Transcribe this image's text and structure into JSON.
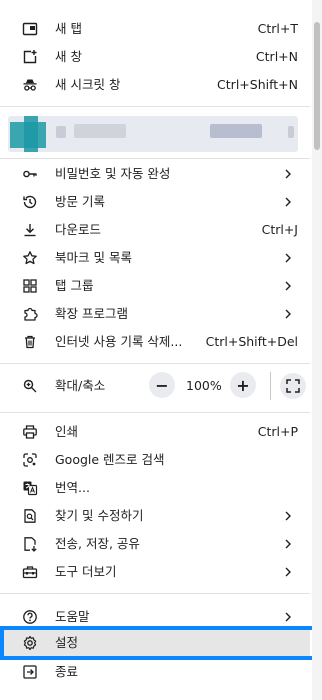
{
  "menu": {
    "new_tab": {
      "label": "새 탭",
      "shortcut": "Ctrl+T",
      "icon": "new-tab-icon"
    },
    "new_window": {
      "label": "새 창",
      "shortcut": "Ctrl+N",
      "icon": "new-window-icon"
    },
    "incognito": {
      "label": "새 시크릿 창",
      "shortcut": "Ctrl+Shift+N",
      "icon": "incognito-icon"
    },
    "passwords": {
      "label": "비밀번호 및 자동 완성",
      "icon": "key-icon"
    },
    "history": {
      "label": "방문 기록",
      "icon": "history-icon"
    },
    "downloads": {
      "label": "다운로드",
      "shortcut": "Ctrl+J",
      "icon": "download-icon"
    },
    "bookmarks": {
      "label": "북마크 및 목록",
      "icon": "star-icon"
    },
    "tab_groups": {
      "label": "탭 그룹",
      "icon": "tab-groups-icon"
    },
    "extensions": {
      "label": "확장 프로그램",
      "icon": "puzzle-icon"
    },
    "clear_data": {
      "label": "인터넷 사용 기록 삭제...",
      "shortcut": "Ctrl+Shift+Del",
      "icon": "trash-icon"
    },
    "zoom": {
      "label": "확대/축소",
      "minus": "−",
      "value": "100%",
      "plus": "+",
      "icon": "zoom-icon"
    },
    "print": {
      "label": "인쇄",
      "shortcut": "Ctrl+P",
      "icon": "print-icon"
    },
    "lens": {
      "label": "Google 렌즈로 검색",
      "icon": "lens-icon"
    },
    "translate": {
      "label": "번역...",
      "icon": "translate-icon"
    },
    "find_edit": {
      "label": "찾기 및 수정하기",
      "icon": "find-icon"
    },
    "cast_save_share": {
      "label": "전송, 저장, 공유",
      "icon": "cast-icon"
    },
    "more_tools": {
      "label": "도구 더보기",
      "icon": "toolbox-icon"
    },
    "help": {
      "label": "도움말",
      "icon": "help-icon"
    },
    "settings": {
      "label": "설정",
      "icon": "gear-icon"
    },
    "exit": {
      "label": "종료",
      "icon": "exit-icon"
    }
  },
  "colors": {
    "highlight_border": "#0a86ff",
    "profile_bg": "#e8eaf2",
    "avatar": "#3aa7b0"
  }
}
